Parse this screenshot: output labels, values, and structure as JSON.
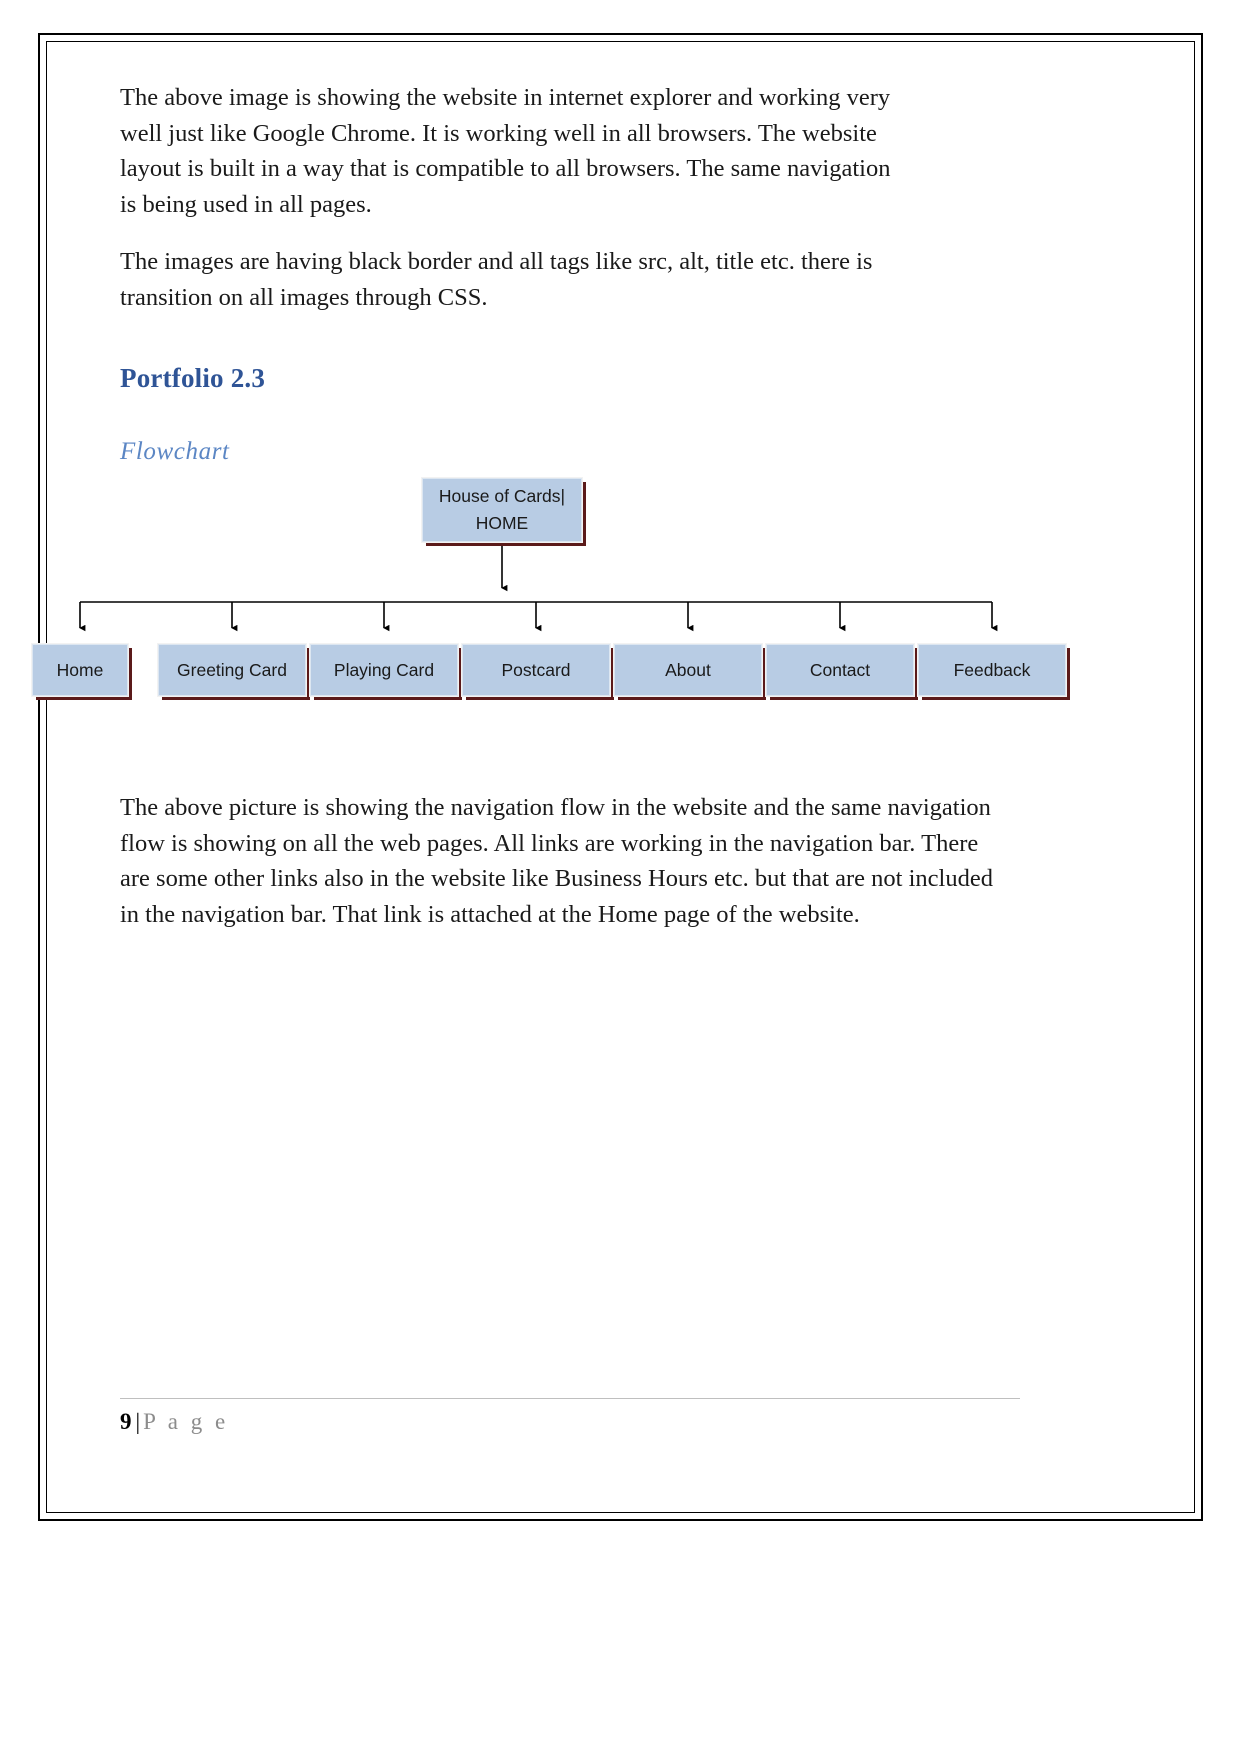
{
  "document": {
    "paragraph_1": "The above image is showing the website in internet explorer and working very well just like Google Chrome. It is working well in all browsers. The website layout is built in a way that is compatible to all browsers. The same navigation is being used in all pages.",
    "paragraph_2": "The images are having black border and all tags like src, alt, title etc. there is transition on all images through CSS.",
    "heading_portfolio": "Portfolio 2.3",
    "heading_flowchart": "Flowchart",
    "paragraph_3": "The above picture is showing the navigation flow in the website and the same navigation flow is showing on all the web pages. All links are working in the navigation bar. There are some other links also in the website like Business Hours etc. but that are not included in the navigation bar. That link is attached at the Home page of the website."
  },
  "flowchart": {
    "root": {
      "line1": "House of Cards|",
      "line2": "HOME"
    },
    "nodes": [
      {
        "label": "Home"
      },
      {
        "label": "Greeting Card"
      },
      {
        "label": "Playing Card"
      },
      {
        "label": "Postcard"
      },
      {
        "label": "About"
      },
      {
        "label": "Contact"
      },
      {
        "label": "Feedback"
      }
    ],
    "colors": {
      "fill": "#b8cce4",
      "shadow": "#5b1a1a",
      "connector": "#000000"
    }
  },
  "footer": {
    "page_number": "9",
    "separator": "|",
    "page_word": "P a g e"
  }
}
